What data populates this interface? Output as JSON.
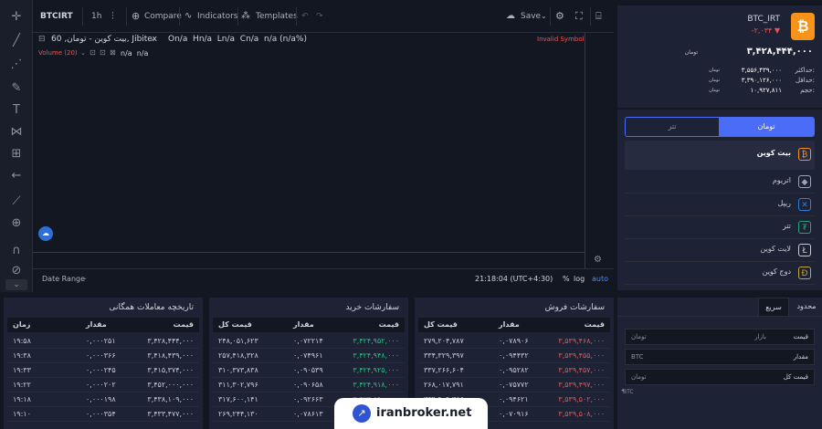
{
  "toolbar": {
    "symbol": "BTCIRT",
    "interval": "1h",
    "compare": "Compare",
    "indicators": "Indicators",
    "templates": "Templates",
    "save": "Save"
  },
  "chart": {
    "legend_title": "بیت کوین - تومان, 60, Jibitex",
    "ohlc": "On/a  Hn/a  Ln/a  Cn/a  n/a (n/a%)",
    "invalid": "Invalid Symbol",
    "volume_label": "Volume (20)",
    "volume_values": "n/a  n/a",
    "date_range": "Date Range",
    "time": "21:18:04 (UTC+4:30)",
    "percent": "%",
    "log": "log",
    "auto": "auto"
  },
  "price_card": {
    "pair": "BTC_IRT",
    "change": "-۲,۰۳۴ ▼",
    "price": "۳,۴۲۸,۴۴۴,۰۰۰",
    "price_unit": "تومان",
    "stats": [
      {
        "label": "حداکثر:",
        "value": "۳,۵۵۶,۴۳۹,۰۰۰",
        "unit": "تومان"
      },
      {
        "label": "حداقل:",
        "value": "۳,۳۹۰,۱۲۶,۰۰۰",
        "unit": "تومان"
      },
      {
        "label": "حجم:",
        "value": "۱۰,۹۲۷,۸۱۱",
        "unit": "تومان"
      }
    ]
  },
  "market": {
    "tab_toman": "تومان",
    "tab_tether": "تتر",
    "items": [
      {
        "name": "بیت کوین",
        "icon": "bitcoin-icon",
        "glyph": "₿",
        "color": "#f7931a"
      },
      {
        "name": "اتریوم",
        "icon": "ethereum-icon",
        "glyph": "◆",
        "color": "#9aa3b5"
      },
      {
        "name": "ریپل",
        "icon": "ripple-icon",
        "glyph": "✕",
        "color": "#2f7fd6"
      },
      {
        "name": "تتر",
        "icon": "tether-icon",
        "glyph": "₮",
        "color": "#26a17b"
      },
      {
        "name": "لایت کوین",
        "icon": "litecoin-icon",
        "glyph": "Ł",
        "color": "#c9ccd6"
      },
      {
        "name": "دوج کوین",
        "icon": "dogecoin-icon",
        "glyph": "Ð",
        "color": "#c2a633"
      }
    ]
  },
  "tables": {
    "history": {
      "title": "تاریخچه معاملات همگانی",
      "headers": {
        "price": "قیمت",
        "amount": "مقدار",
        "time": "زمان"
      },
      "rows": [
        {
          "price": "۳,۴۲۸,۴۴۴,۰۰۰",
          "amount": "۰,۰۰۰۲۵۱",
          "time": "۱۹:۵۸"
        },
        {
          "price": "۳,۴۱۸,۴۳۹,۰۰۰",
          "amount": "۰,۰۰۰۳۶۶",
          "time": "۱۹:۳۸"
        },
        {
          "price": "۳,۴۱۵,۳۷۴,۰۰۰",
          "amount": "۰,۰۰۰۲۴۵",
          "time": "۱۹:۳۳"
        },
        {
          "price": "۳,۴۵۲,۰۰۰,۰۰۰",
          "amount": "۰,۰۰۰۲۰۲",
          "time": "۱۹:۲۲"
        },
        {
          "price": "۳,۴۳۸,۱۰۹,۰۰۰",
          "amount": "۰,۰۰۰۱۹۸",
          "time": "۱۹:۱۸"
        },
        {
          "price": "۳,۴۳۳,۴۷۷,۰۰۰",
          "amount": "۰,۰۰۰۳۵۴",
          "time": "۱۹:۱۰"
        }
      ]
    },
    "buy": {
      "title": "سفارشات خرید",
      "headers": {
        "price": "قیمت",
        "amount": "مقدار",
        "total": "قیمت کل"
      },
      "rows": [
        {
          "price": "۳,۴۲۴,۹۵۲,۰۰۰",
          "amount": "۰,۰۷۲۲۱۴",
          "total": "۲۴۸,۰۵۱,۶۲۳"
        },
        {
          "price": "۳,۴۲۴,۹۴۸,۰۰۰",
          "amount": "۰,۰۷۴۹۶۱",
          "total": "۲۵۷,۴۱۸,۳۲۸"
        },
        {
          "price": "۳,۴۲۴,۹۲۵,۰۰۰",
          "amount": "۰,۰۹۰۵۳۹",
          "total": "۳۱۰,۳۷۳,۸۳۸"
        },
        {
          "price": "۳,۴۲۴,۹۱۸,۰۰۰",
          "amount": "۰,۰۹۰۶۵۸",
          "total": "۳۱۱,۳۰۲,۷۹۶"
        },
        {
          "price": "۳,۴۲۴,۸۹۰,۰۰۰",
          "amount": "۰,۰۹۲۶۶۳",
          "total": "۳۱۷,۶۰۰,۱۴۱"
        },
        {
          "price": "۳,۴۲۴,۸۶۵,۰۰۰",
          "amount": "۰,۰۷۸۶۱۳",
          "total": "۲۶۹,۲۴۴,۱۳۰"
        }
      ]
    },
    "sell": {
      "title": "سفارشات فروش",
      "headers": {
        "price": "قیمت",
        "amount": "مقدار",
        "total": "قیمت کل"
      },
      "rows": [
        {
          "price": "۳,۵۳۹,۴۶۸,۰۰۰",
          "amount": "۰,۰۷۸۹۰۶",
          "total": "۲۷۹,۲۰۴,۷۸۷"
        },
        {
          "price": "۳,۵۳۹,۴۵۵,۰۰۰",
          "amount": "۰,۰۹۴۴۳۲",
          "total": "۳۳۴,۳۲۹,۳۹۷"
        },
        {
          "price": "۳,۵۳۹,۴۵۷,۰۰۰",
          "amount": "۰,۰۹۵۲۸۲",
          "total": "۳۳۷,۲۶۶,۶۰۴"
        },
        {
          "price": "۳,۵۳۹,۴۹۷,۰۰۰",
          "amount": "۰,۰۷۵۷۷۲",
          "total": "۲۶۸,۰۱۷,۷۹۱"
        },
        {
          "price": "۳,۵۳۹,۵۰۲,۰۰۰",
          "amount": "۰,۰۹۴۶۲۱",
          "total": "۳۳۴,۹۰۹,۳۶۶"
        },
        {
          "price": "۳,۵۳۹,۵۰۸,۰۰۰",
          "amount": "۰,۰۷۰۹۱۶",
          "total": "۲۵۱,۰۰۷,۸۸۰"
        }
      ]
    }
  },
  "trade": {
    "tab_limit": "محدود",
    "tab_fast": "سریع",
    "price_label": "قیمت",
    "price_value": "بازار",
    "price_unit": "تومان",
    "amount_label": "مقدار",
    "amount_unit": "BTC",
    "total_label": "قیمت کل",
    "total_unit": "تومان",
    "footer": "BTC"
  },
  "watermark": {
    "text": "iranbroker.net"
  },
  "colors": {
    "accent": "#4a6cf7",
    "buy": "#26c281",
    "sell": "#ef5350",
    "bitcoin": "#f7931a"
  }
}
